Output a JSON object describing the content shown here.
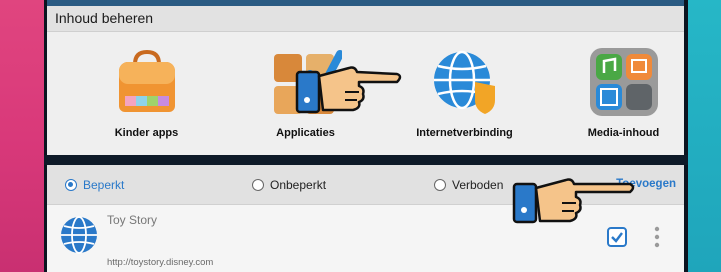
{
  "manage_panel": {
    "title": "Inhoud beheren",
    "tiles": [
      {
        "label": "Kinder apps",
        "icon": "shopping-bag-icon"
      },
      {
        "label": "Applicaties",
        "icon": "apps-grid-icon"
      },
      {
        "label": "Internetverbinding",
        "icon": "globe-shield-icon"
      },
      {
        "label": "Media-inhoud",
        "icon": "media-folder-icon"
      }
    ]
  },
  "web_panel": {
    "options": [
      {
        "label": "Beperkt",
        "selected": true
      },
      {
        "label": "Onbeperkt",
        "selected": false
      },
      {
        "label": "Verboden",
        "selected": false
      }
    ],
    "add_label": "Toevoegen",
    "site": {
      "name": "Toy Story",
      "url": "http://toystory.disney.com",
      "checked": true,
      "icon": "globe-icon"
    }
  },
  "colors": {
    "accent_blue": "#2a79c9",
    "left_band": "#e0457f",
    "right_band": "#26b7c7",
    "header_blue": "#2a5b83"
  },
  "pointer_icons": [
    "pointing-hand-icon",
    "pointing-hand-icon"
  ]
}
